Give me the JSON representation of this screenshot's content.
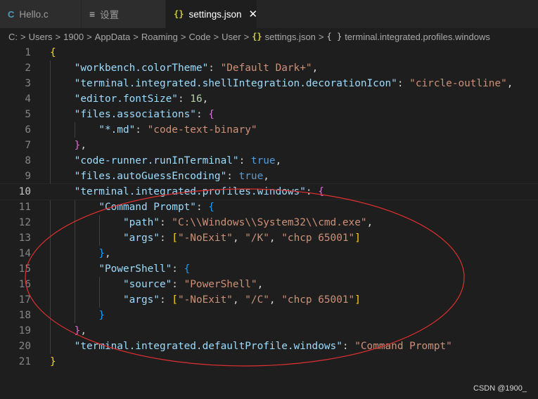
{
  "tabs": [
    {
      "label": "Hello.c",
      "icon": "c-file-icon",
      "glyph": "C"
    },
    {
      "label": "设置",
      "icon": "settings-list-icon",
      "glyph": "≡"
    },
    {
      "label": "settings.json",
      "icon": "json-braces-icon",
      "glyph": "{}",
      "active": true,
      "close": "✕"
    }
  ],
  "breadcrumb": {
    "items": [
      "C:",
      "Users",
      "1900",
      "AppData",
      "Roaming",
      "Code",
      "User",
      "settings.json",
      "terminal.integrated.profiles.windows"
    ],
    "separator": ">",
    "json_glyph": "{}",
    "symbol_glyph": "{ }"
  },
  "editor": {
    "current_line": 10,
    "lines": [
      [
        [
          "{",
          "b1"
        ]
      ],
      [
        [
          "    ",
          "p"
        ],
        [
          "\"workbench.colorTheme\"",
          "key"
        ],
        [
          ": ",
          "p"
        ],
        [
          "\"Default Dark+\"",
          "str"
        ],
        [
          ",",
          "p"
        ]
      ],
      [
        [
          "    ",
          "p"
        ],
        [
          "\"terminal.integrated.shellIntegration.decorationIcon\"",
          "key"
        ],
        [
          ": ",
          "p"
        ],
        [
          "\"circle-outline\"",
          "str"
        ],
        [
          ",",
          "p"
        ]
      ],
      [
        [
          "    ",
          "p"
        ],
        [
          "\"editor.fontSize\"",
          "key"
        ],
        [
          ": ",
          "p"
        ],
        [
          "16",
          "num"
        ],
        [
          ",",
          "p"
        ]
      ],
      [
        [
          "    ",
          "p"
        ],
        [
          "\"files.associations\"",
          "key"
        ],
        [
          ": ",
          "p"
        ],
        [
          "{",
          "b2"
        ]
      ],
      [
        [
          "        ",
          "p"
        ],
        [
          "\"*.md\"",
          "key"
        ],
        [
          ": ",
          "p"
        ],
        [
          "\"code-text-binary\"",
          "str"
        ]
      ],
      [
        [
          "    ",
          "p"
        ],
        [
          "}",
          "b2"
        ],
        [
          ",",
          "p"
        ]
      ],
      [
        [
          "    ",
          "p"
        ],
        [
          "\"code-runner.runInTerminal\"",
          "key"
        ],
        [
          ": ",
          "p"
        ],
        [
          "true",
          "bool"
        ],
        [
          ",",
          "p"
        ]
      ],
      [
        [
          "    ",
          "p"
        ],
        [
          "\"files.autoGuessEncoding\"",
          "key"
        ],
        [
          ": ",
          "p"
        ],
        [
          "true",
          "bool"
        ],
        [
          ",",
          "p"
        ]
      ],
      [
        [
          "    ",
          "p"
        ],
        [
          "\"terminal.integrated.profiles.windows\"",
          "key"
        ],
        [
          ": ",
          "p"
        ],
        [
          "{",
          "b2"
        ]
      ],
      [
        [
          "        ",
          "p"
        ],
        [
          "\"Command Prompt\"",
          "key"
        ],
        [
          ": ",
          "p"
        ],
        [
          "{",
          "b3"
        ]
      ],
      [
        [
          "            ",
          "p"
        ],
        [
          "\"path\"",
          "key"
        ],
        [
          ": ",
          "p"
        ],
        [
          "\"C:\\\\Windows\\\\System32\\\\cmd.exe\"",
          "str"
        ],
        [
          ",",
          "p"
        ]
      ],
      [
        [
          "            ",
          "p"
        ],
        [
          "\"args\"",
          "key"
        ],
        [
          ": ",
          "p"
        ],
        [
          "[",
          "b1"
        ],
        [
          "\"-NoExit\"",
          "str"
        ],
        [
          ", ",
          "p"
        ],
        [
          "\"/K\"",
          "str"
        ],
        [
          ", ",
          "p"
        ],
        [
          "\"chcp 65001\"",
          "str"
        ],
        [
          "]",
          "b1"
        ]
      ],
      [
        [
          "        ",
          "p"
        ],
        [
          "}",
          "b3"
        ],
        [
          ",",
          "p"
        ]
      ],
      [
        [
          "        ",
          "p"
        ],
        [
          "\"PowerShell\"",
          "key"
        ],
        [
          ": ",
          "p"
        ],
        [
          "{",
          "b3"
        ]
      ],
      [
        [
          "            ",
          "p"
        ],
        [
          "\"source\"",
          "key"
        ],
        [
          ": ",
          "p"
        ],
        [
          "\"PowerShell\"",
          "str"
        ],
        [
          ",",
          "p"
        ]
      ],
      [
        [
          "            ",
          "p"
        ],
        [
          "\"args\"",
          "key"
        ],
        [
          ": ",
          "p"
        ],
        [
          "[",
          "b1"
        ],
        [
          "\"-NoExit\"",
          "str"
        ],
        [
          ", ",
          "p"
        ],
        [
          "\"/C\"",
          "str"
        ],
        [
          ", ",
          "p"
        ],
        [
          "\"chcp 65001\"",
          "str"
        ],
        [
          "]",
          "b1"
        ]
      ],
      [
        [
          "        ",
          "p"
        ],
        [
          "}",
          "b3"
        ]
      ],
      [
        [
          "    ",
          "p"
        ],
        [
          "}",
          "b2"
        ],
        [
          ",",
          "p"
        ]
      ],
      [
        [
          "    ",
          "p"
        ],
        [
          "\"terminal.integrated.defaultProfile.windows\"",
          "key"
        ],
        [
          ": ",
          "p"
        ],
        [
          "\"Command Prompt\"",
          "str"
        ]
      ],
      [
        [
          "}",
          "b1"
        ]
      ]
    ]
  },
  "colors": {
    "annotation_ellipse": "#e03030",
    "key": "#9cdcfe",
    "string": "#ce9178",
    "number": "#b5cea8",
    "boolean": "#569cd6",
    "bracket_level1": "#ffd700",
    "bracket_level2": "#da70d6",
    "bracket_level3": "#179fff"
  },
  "watermark": "CSDN @1900_"
}
